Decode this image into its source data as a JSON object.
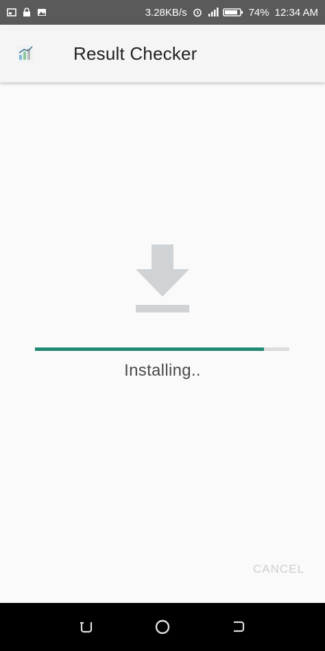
{
  "status_bar": {
    "left_icons": [
      "screen-cast-icon",
      "lock-icon",
      "image-icon"
    ],
    "network_speed": "3.28KB/s",
    "battery": "74%",
    "time": "12:34 AM",
    "right_icons": [
      "alarm-icon",
      "signal-icon",
      "battery-icon"
    ]
  },
  "app_bar": {
    "icon": "app-logo-icon",
    "title": "Result Checker"
  },
  "install": {
    "icon": "download-icon",
    "progress": 0.9,
    "status_text": "Installing..",
    "cancel_label": "CANCEL"
  },
  "colors": {
    "status_bar_bg": "#5a5a5a",
    "progress_fill": "#1f8a74",
    "progress_track": "#dcdcdc",
    "download_icon": "#cfd3d6",
    "cancel_text": "#cfcfcf"
  },
  "nav_bar": {
    "buttons": [
      "recents-icon",
      "home-icon",
      "back-icon"
    ]
  }
}
